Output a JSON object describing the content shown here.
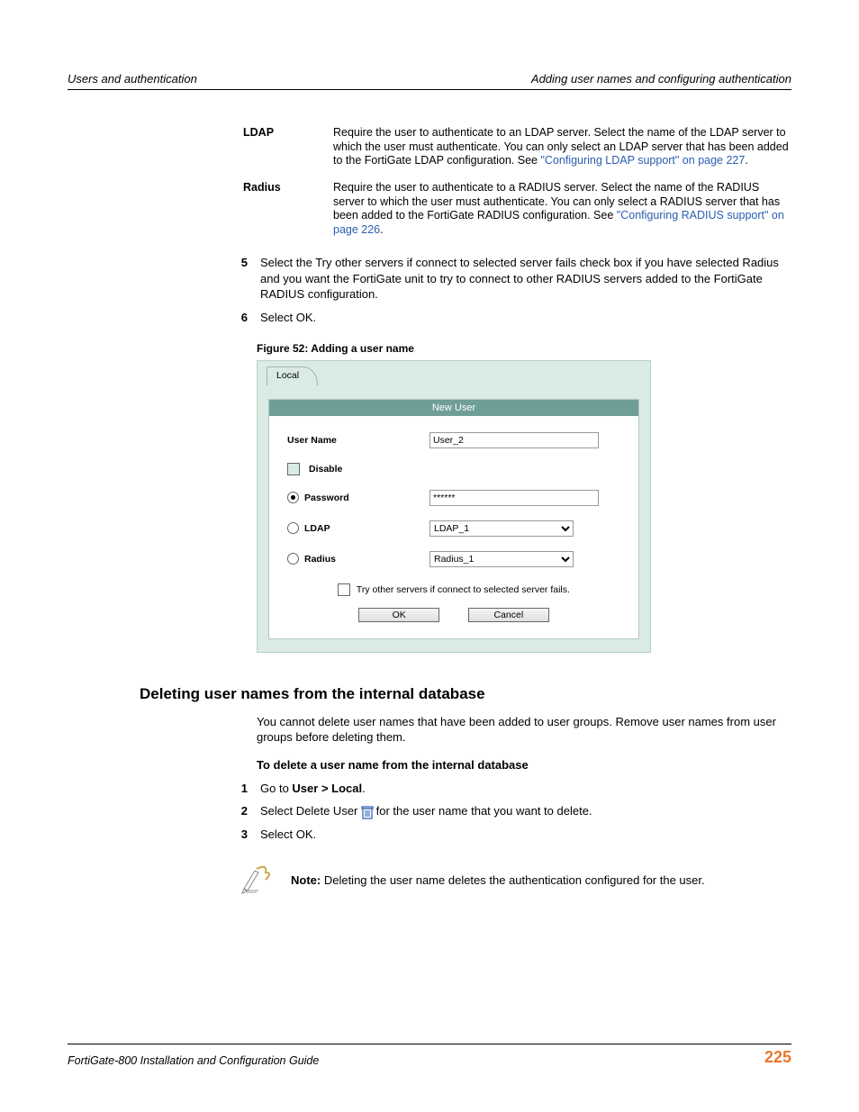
{
  "header": {
    "left": "Users and authentication",
    "right": "Adding user names and configuring authentication"
  },
  "defs": {
    "ldap_term": "LDAP",
    "ldap_desc_a": "Require the user to authenticate to an LDAP server. Select the name of the LDAP server to which the user must authenticate. You can only select an LDAP server that has been added to the FortiGate LDAP configuration. See ",
    "ldap_link": "\"Configuring LDAP support\" on page 227",
    "ldap_desc_b": ".",
    "radius_term": "Radius",
    "radius_desc_a": "Require the user to authenticate to a RADIUS server. Select the name of the RADIUS server to which the user must authenticate. You can only select a RADIUS server that has been added to the FortiGate RADIUS configuration. See ",
    "radius_link": "\"Configuring RADIUS support\" on page 226",
    "radius_desc_b": "."
  },
  "steps_a": {
    "n5": "5",
    "t5": "Select the Try other servers if connect to selected server fails check box if you have selected Radius and you want the FortiGate unit to try to connect to other RADIUS servers added to the FortiGate RADIUS configuration.",
    "n6": "6",
    "t6": "Select OK."
  },
  "figure_caption": "Figure 52: Adding a user name",
  "figure": {
    "tab": "Local",
    "title": "New User",
    "row_username": "User Name",
    "row_disable": "Disable",
    "row_password": "Password",
    "row_ldap": "LDAP",
    "row_radius": "Radius",
    "val_username": "User_2",
    "val_password": "******",
    "val_ldap": "LDAP_1",
    "val_radius": "Radius_1",
    "try_label": "Try other servers if connect to selected server fails.",
    "btn_ok": "OK",
    "btn_cancel": "Cancel"
  },
  "section_heading": "Deleting user names from the internal database",
  "section_para": "You cannot delete user names that have been added to user groups. Remove user names from user groups before deleting them.",
  "sub_heading": "To delete a user name from the internal database",
  "steps_b": {
    "n1": "1",
    "t1a": "Go to ",
    "t1b": "User > Local",
    "t1c": ".",
    "n2": "2",
    "t2a": "Select Delete User ",
    "t2b": " for the user name that you want to delete.",
    "n3": "3",
    "t3": "Select OK."
  },
  "note": {
    "label": "Note:",
    "text": " Deleting the user name deletes the authentication configured for the user."
  },
  "footer": {
    "left": "FortiGate-800 Installation and Configuration Guide",
    "page": "225"
  }
}
